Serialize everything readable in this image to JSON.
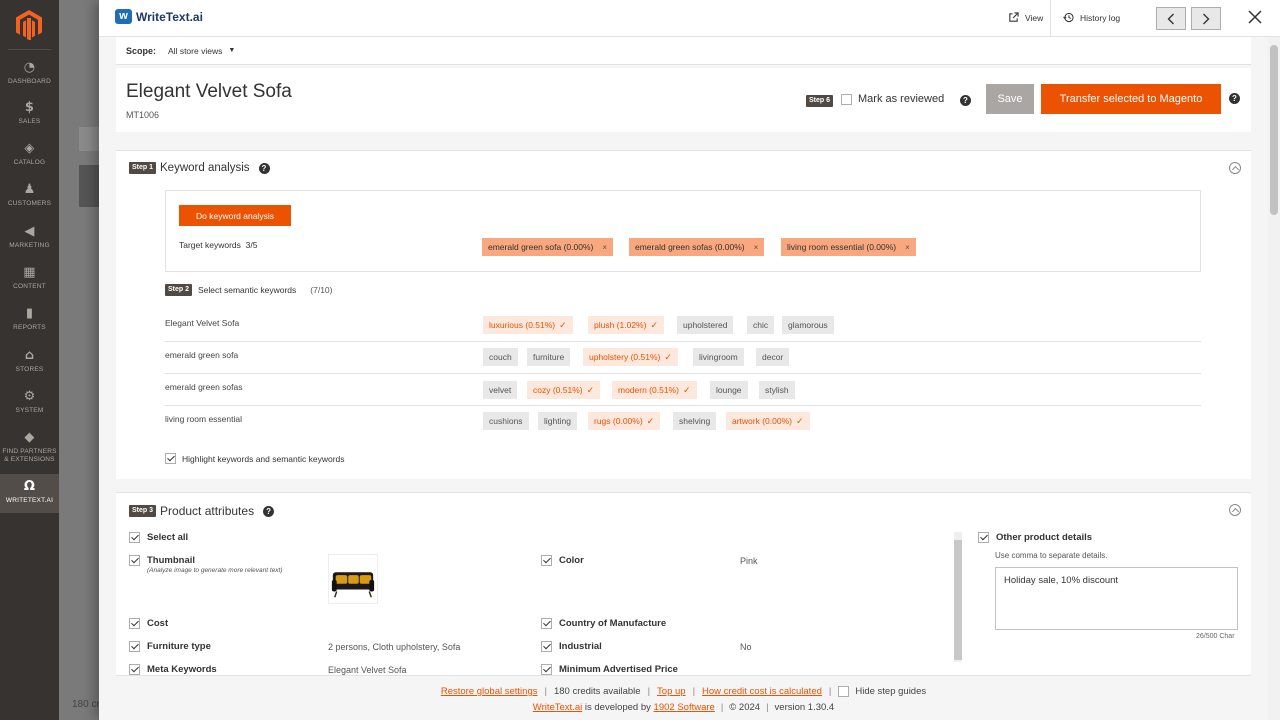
{
  "sidebar": {
    "items": [
      {
        "label": "DASHBOARD",
        "icon": "dashboard-icon"
      },
      {
        "label": "SALES",
        "icon": "dollar-icon"
      },
      {
        "label": "CATALOG",
        "icon": "cube-icon"
      },
      {
        "label": "CUSTOMERS",
        "icon": "person-icon"
      },
      {
        "label": "MARKETING",
        "icon": "megaphone-icon"
      },
      {
        "label": "CONTENT",
        "icon": "layout-icon"
      },
      {
        "label": "REPORTS",
        "icon": "bar-chart-icon"
      },
      {
        "label": "STORES",
        "icon": "store-icon"
      },
      {
        "label": "SYSTEM",
        "icon": "gear-icon"
      },
      {
        "label": "FIND PARTNERS & EXTENSIONS",
        "icon": "box-icon"
      },
      {
        "label": "WRITETEXT.AI",
        "icon": "writetext-icon"
      }
    ]
  },
  "background": {
    "footer_text": "180 cr"
  },
  "header": {
    "logo_text": "WriteText.ai",
    "view_label": "View",
    "history_label": "History log"
  },
  "scope": {
    "label": "Scope:",
    "value": "All store views"
  },
  "product": {
    "title": "Elegant Velvet Sofa",
    "sku": "MT1006",
    "step6_badge": "Step 6",
    "mark_reviewed_label": "Mark as reviewed",
    "save_label": "Save",
    "transfer_label": "Transfer selected to Magento"
  },
  "step1": {
    "badge": "Step 1",
    "title": "Keyword analysis",
    "do_button": "Do keyword analysis",
    "target_label": "Target keywords",
    "target_count": "3/5",
    "target_keywords": [
      "emerald green sofa (0.00%)",
      "emerald green sofas (0.00%)",
      "living room essential (0.00%)"
    ]
  },
  "step2": {
    "badge": "Step 2",
    "title": "Select semantic keywords",
    "count": "(7/10)",
    "rows": [
      {
        "label": "Elegant Velvet Sofa",
        "chips": [
          {
            "text": "luxurious (0.51%)",
            "selected": true
          },
          {
            "text": "plush (1.02%)",
            "selected": true
          },
          {
            "text": "upholstered",
            "selected": false
          },
          {
            "text": "chic",
            "selected": false
          },
          {
            "text": "glamorous",
            "selected": false
          }
        ]
      },
      {
        "label": "emerald green sofa",
        "chips": [
          {
            "text": "couch",
            "selected": false
          },
          {
            "text": "furniture",
            "selected": false
          },
          {
            "text": "upholstery (0.51%)",
            "selected": true
          },
          {
            "text": "livingroom",
            "selected": false
          },
          {
            "text": "decor",
            "selected": false
          }
        ]
      },
      {
        "label": "emerald green sofas",
        "chips": [
          {
            "text": "velvet",
            "selected": false
          },
          {
            "text": "cozy (0.51%)",
            "selected": true
          },
          {
            "text": "modern (0.51%)",
            "selected": true
          },
          {
            "text": "lounge",
            "selected": false
          },
          {
            "text": "stylish",
            "selected": false
          }
        ]
      },
      {
        "label": "living room essential",
        "chips": [
          {
            "text": "cushions",
            "selected": false
          },
          {
            "text": "lighting",
            "selected": false
          },
          {
            "text": "rugs (0.00%)",
            "selected": true
          },
          {
            "text": "shelving",
            "selected": false
          },
          {
            "text": "artwork (0.00%)",
            "selected": true
          }
        ]
      }
    ],
    "highlight_label": "Highlight keywords and semantic keywords"
  },
  "step3": {
    "badge": "Step 3",
    "title": "Product attributes",
    "select_all": "Select all",
    "attributes": {
      "thumbnail": {
        "label": "Thumbnail",
        "sub": "(Analyze image to generate more relevant text)"
      },
      "color": {
        "label": "Color",
        "value": "Pink"
      },
      "cost": {
        "label": "Cost"
      },
      "country": {
        "label": "Country of Manufacture"
      },
      "furniture_type": {
        "label": "Furniture type",
        "value": "2 persons, Cloth upholstery, Sofa"
      },
      "industrial": {
        "label": "Industrial",
        "value": "No"
      },
      "meta_keywords": {
        "label": "Meta Keywords",
        "value": "Elegant Velvet Sofa"
      },
      "min_price": {
        "label": "Minimum Advertised Price"
      }
    },
    "other": {
      "label": "Other product details",
      "hint": "Use comma to separate details.",
      "value": "Holiday sale, 10% discount",
      "char_count": "26/500 Char"
    }
  },
  "footer": {
    "restore": "Restore global settings",
    "credits": "180 credits available",
    "top_up": "Top up",
    "how_cost": "How credit cost is calculated",
    "hide_guides": "Hide step guides",
    "brand": "WriteText.ai",
    "developed_by": "is developed by",
    "company": "1902 Software",
    "copyright": "© 2024",
    "version": "version 1.30.4"
  },
  "colors": {
    "accent": "#eb5202",
    "sidebar_bg": "#373330",
    "target_chip": "#f9a77e",
    "selected_chip_bg": "#fde8de"
  }
}
